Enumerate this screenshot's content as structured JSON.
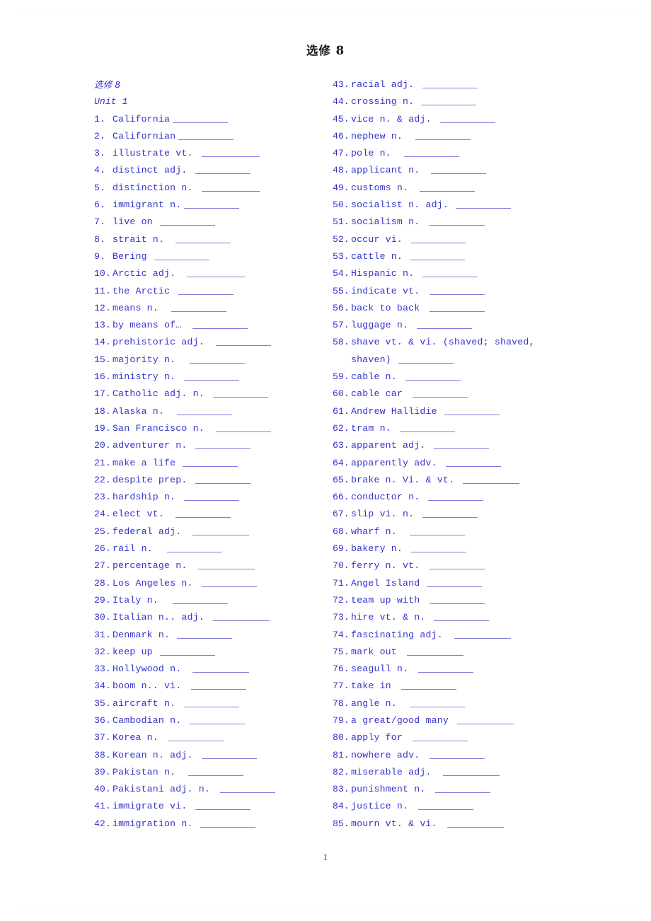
{
  "document": {
    "title": "选修 8",
    "page_number": "1"
  },
  "headings": {
    "book": "选修 8",
    "unit": "Unit 1"
  },
  "columns": {
    "left": [
      {
        "num": "1.",
        "term": "California",
        "blank": 78,
        "gap": 0
      },
      {
        "num": "2.",
        "term": "Californian",
        "blank": 78,
        "gap": 0
      },
      {
        "num": "3.",
        "term": "illustrate  vt.",
        "blank": 82,
        "gap": 8
      },
      {
        "num": "4.",
        "term": "distinct  adj.",
        "blank": 78,
        "gap": 8
      },
      {
        "num": "5.",
        "term": "distinction  n.",
        "blank": 82,
        "gap": 8
      },
      {
        "num": "6.",
        "term": "immigrant  n.",
        "blank": 78,
        "gap": 0
      },
      {
        "num": "7.",
        "term": "live on",
        "blank": 78,
        "gap": 6
      },
      {
        "num": "8.",
        "term": "strait  n.",
        "blank": 78,
        "gap": 12
      },
      {
        "num": "9.",
        "term": "Bering",
        "blank": 78,
        "gap": 6
      },
      {
        "num": "10.",
        "term": "Arctic  adj.",
        "blank": 82,
        "gap": 12
      },
      {
        "num": "11.",
        "term": "the Arctic",
        "blank": 78,
        "gap": 8
      },
      {
        "num": "12.",
        "term": "means  n.",
        "blank": 78,
        "gap": 14
      },
      {
        "num": "13.",
        "term": "by means of…",
        "blank": 78,
        "gap": 12
      },
      {
        "num": "14.",
        "term": "prehistoric  adj.",
        "blank": 78,
        "gap": 12
      },
      {
        "num": "15.",
        "term": "majority  n.",
        "blank": 78,
        "gap": 16
      },
      {
        "num": "16.",
        "term": "ministry  n.",
        "blank": 78,
        "gap": 8
      },
      {
        "num": "17.",
        "term": "Catholic  adj.  n.",
        "blank": 78,
        "gap": 8
      },
      {
        "num": "18.",
        "term": "Alaska  n.",
        "blank": 78,
        "gap": 14
      },
      {
        "num": "19.",
        "term": "San Francisco n.",
        "blank": 78,
        "gap": 12
      },
      {
        "num": "20.",
        "term": "adventurer  n.",
        "blank": 78,
        "gap": 8
      },
      {
        "num": "21.",
        "term": "make a life",
        "blank": 78,
        "gap": 6
      },
      {
        "num": "22.",
        "term": "despite  prep.",
        "blank": 78,
        "gap": 8
      },
      {
        "num": "23.",
        "term": "hardship  n.",
        "blank": 78,
        "gap": 8
      },
      {
        "num": "24.",
        "term": "elect  vt.",
        "blank": 78,
        "gap": 12
      },
      {
        "num": "25.",
        "term": "federal  adj.",
        "blank": 80,
        "gap": 12
      },
      {
        "num": "26.",
        "term": "rail  n.",
        "blank": 78,
        "gap": 16
      },
      {
        "num": "27.",
        "term": "percentage  n.",
        "blank": 80,
        "gap": 12
      },
      {
        "num": "28.",
        "term": "Los Angeles  n.",
        "blank": 78,
        "gap": 8
      },
      {
        "num": "29.",
        "term": "Italy  n.",
        "blank": 78,
        "gap": 16
      },
      {
        "num": "30.",
        "term": "Italian  n.. adj.",
        "blank": 80,
        "gap": 8
      },
      {
        "num": "31.",
        "term": "Denmark  n.",
        "blank": 78,
        "gap": 6
      },
      {
        "num": "32.",
        "term": "keep up",
        "blank": 78,
        "gap": 6
      },
      {
        "num": "33.",
        "term": "Hollywood  n.",
        "blank": 80,
        "gap": 12
      },
      {
        "num": "34.",
        "term": "boom  n.. vi.",
        "blank": 78,
        "gap": 10
      },
      {
        "num": "35.",
        "term": "aircraft  n.",
        "blank": 78,
        "gap": 8
      },
      {
        "num": "36.",
        "term": "Cambodian  n.",
        "blank": 78,
        "gap": 8
      },
      {
        "num": "37.",
        "term": "Korea  n.",
        "blank": 78,
        "gap": 10
      },
      {
        "num": "38.",
        "term": "Korean  n.  adj.",
        "blank": 78,
        "gap": 8
      },
      {
        "num": "39.",
        "term": "Pakistan  n.",
        "blank": 78,
        "gap": 14
      },
      {
        "num": "40.",
        "term": "Pakistani  adj.  n.",
        "blank": 78,
        "gap": 10
      },
      {
        "num": "41.",
        "term": "immigrate  vi.",
        "blank": 78,
        "gap": 8
      },
      {
        "num": "42.",
        "term": "immigration  n.",
        "blank": 78,
        "gap": 6
      }
    ],
    "right": [
      {
        "num": "43.",
        "term": "racial  adj.",
        "blank": 78,
        "gap": 8
      },
      {
        "num": "44.",
        "term": "crossing  n.",
        "blank": 78,
        "gap": 6
      },
      {
        "num": "45.",
        "term": "vice  n. & adj.",
        "blank": 78,
        "gap": 8
      },
      {
        "num": "46.",
        "term": "nephew  n.",
        "blank": 78,
        "gap": 14
      },
      {
        "num": "47.",
        "term": "pole  n.",
        "blank": 78,
        "gap": 14
      },
      {
        "num": "48.",
        "term": "applicant  n.",
        "blank": 78,
        "gap": 12
      },
      {
        "num": "49.",
        "term": "customs  n.",
        "blank": 78,
        "gap": 12
      },
      {
        "num": "50.",
        "term": "socialist  n.  adj.",
        "blank": 78,
        "gap": 6
      },
      {
        "num": "51.",
        "term": "socialism  n.",
        "blank": 78,
        "gap": 10
      },
      {
        "num": "52.",
        "term": "occur  vi.",
        "blank": 78,
        "gap": 8
      },
      {
        "num": "53.",
        "term": "cattle  n.",
        "blank": 78,
        "gap": 6
      },
      {
        "num": "54.",
        "term": "Hispanic  n.",
        "blank": 78,
        "gap": 8
      },
      {
        "num": "55.",
        "term": "indicate  vt.",
        "blank": 78,
        "gap": 10
      },
      {
        "num": "56.",
        "term": "back to back",
        "blank": 78,
        "gap": 10
      },
      {
        "num": "57.",
        "term": "luggage  n.",
        "blank": 78,
        "gap": 8
      },
      {
        "num": "58.",
        "term": "shave vt. & vi. (shaved; shaved, shaven)",
        "blank": 78,
        "gap": 6,
        "wrap": true
      },
      {
        "num": "59.",
        "term": "cable  n.",
        "blank": 78,
        "gap": 8
      },
      {
        "num": "60.",
        "term": "cable car",
        "blank": 78,
        "gap": 10
      },
      {
        "num": "61.",
        "term": "Andrew Hallidie",
        "blank": 78,
        "gap": 6
      },
      {
        "num": "62.",
        "term": "tram  n.",
        "blank": 78,
        "gap": 8
      },
      {
        "num": "63.",
        "term": "apparent  adj.",
        "blank": 78,
        "gap": 8
      },
      {
        "num": "64.",
        "term": "apparently  adv.",
        "blank": 78,
        "gap": 8
      },
      {
        "num": "65.",
        "term": "brake  n. Vi. & vt.",
        "blank": 80,
        "gap": 8
      },
      {
        "num": "66.",
        "term": "conductor  n.",
        "blank": 78,
        "gap": 8
      },
      {
        "num": "67.",
        "term": "slip  vi. n.",
        "blank": 78,
        "gap": 8
      },
      {
        "num": "68.",
        "term": "wharf  n.",
        "blank": 78,
        "gap": 14
      },
      {
        "num": "69.",
        "term": "bakery  n.",
        "blank": 78,
        "gap": 8
      },
      {
        "num": "70.",
        "term": "ferry  n.  vt.",
        "blank": 78,
        "gap": 10
      },
      {
        "num": "71.",
        "term": "Angel Island",
        "blank": 78,
        "gap": 6
      },
      {
        "num": "72.",
        "term": "team up with",
        "blank": 78,
        "gap": 10
      },
      {
        "num": "73.",
        "term": "hire  vt. & n.",
        "blank": 78,
        "gap": 8
      },
      {
        "num": "74.",
        "term": "fascinating  adj.",
        "blank": 80,
        "gap": 12
      },
      {
        "num": "75.",
        "term": "mark out",
        "blank": 80,
        "gap": 10
      },
      {
        "num": "76.",
        "term": "seagull  n.",
        "blank": 78,
        "gap": 10
      },
      {
        "num": "77.",
        "term": "take in",
        "blank": 78,
        "gap": 10
      },
      {
        "num": "78.",
        "term": "angle  n.",
        "blank": 78,
        "gap": 14
      },
      {
        "num": "79.",
        "term": "a great/good many",
        "blank": 80,
        "gap": 8
      },
      {
        "num": "80.",
        "term": "apply for",
        "blank": 78,
        "gap": 10
      },
      {
        "num": "81.",
        "term": "nowhere  adv.",
        "blank": 78,
        "gap": 10
      },
      {
        "num": "82.",
        "term": "miserable  adj.",
        "blank": 80,
        "gap": 12
      },
      {
        "num": "83.",
        "term": "punishment  n.",
        "blank": 78,
        "gap": 10
      },
      {
        "num": "84.",
        "term": "justice  n.",
        "blank": 78,
        "gap": 10
      },
      {
        "num": "85.",
        "term": "mourn  vt. & vi.",
        "blank": 80,
        "gap": 10
      }
    ]
  },
  "colors": {
    "text_blue": "#3333cc",
    "blank_rule": "#7b7bdd",
    "title_black": "#1a1a1a"
  }
}
